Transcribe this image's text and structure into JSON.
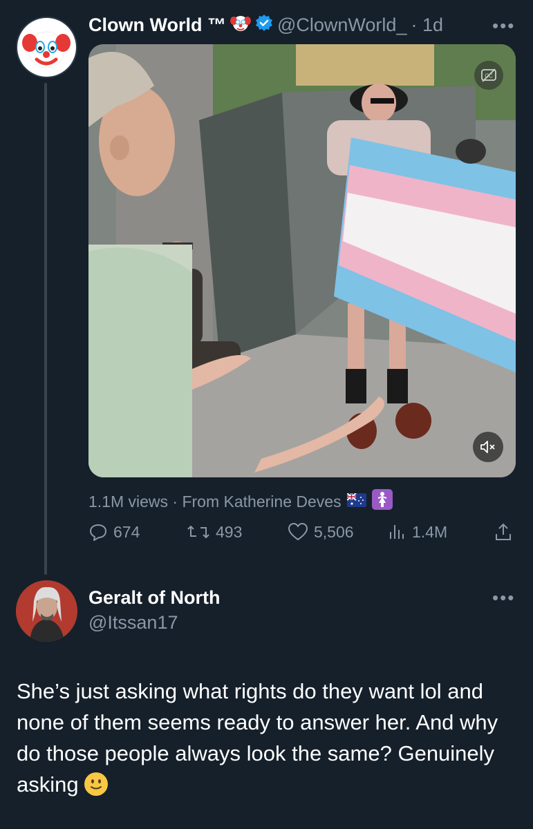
{
  "tweet": {
    "author_name": "Clown World ™",
    "handle": "@ClownWorld_",
    "time": "· 1d",
    "more": "•••",
    "media": {
      "cc_icon": "closed-captions-icon",
      "mute_icon": "speaker-muted-icon"
    },
    "views": "1.1M views · From Katherine Deves",
    "flags": [
      "australia-flag-icon",
      "female-sign-icon"
    ],
    "actions": {
      "replies": "674",
      "retweets": "493",
      "likes": "5,506",
      "views": "1.4M"
    }
  },
  "reply": {
    "author_name": "Geralt of North",
    "handle": "@Itssan17",
    "more": "•••",
    "text": "She’s just asking what rights do they want lol and none of them seems ready to answer her. And why do those people always look the same? Genuinely asking",
    "emoji": "slightly-smiling-face"
  },
  "colors": {
    "background": "#15202b",
    "muted": "#8b98a5",
    "verified": "#1d9bf0",
    "thread_line": "#38444d"
  }
}
